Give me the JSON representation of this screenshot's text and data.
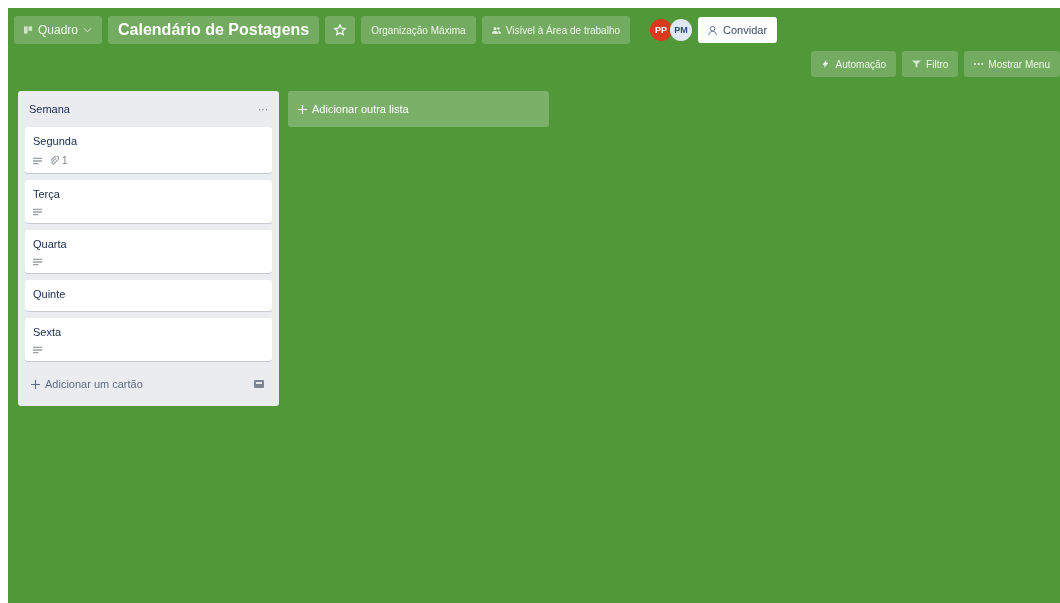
{
  "header": {
    "board_switcher": "Quadro",
    "board_title": "Calendário de Postagens",
    "starred": false,
    "team": "Organização Máxima",
    "visibility": "Visível à Área de trabalho",
    "members": [
      {
        "initials": "PP",
        "color": "#d93a1e"
      },
      {
        "initials": "PM",
        "color": "#dfe8f2"
      }
    ],
    "invite": "Convidar",
    "automation": "Automação",
    "filter": "Filtro",
    "menu": "Mostrar Menu"
  },
  "lists": [
    {
      "title": "Semana",
      "menu": "···",
      "add_card": "Adicionar um cartão",
      "cards": [
        {
          "title": "Segunda",
          "description": true,
          "attachments": "1"
        },
        {
          "title": "Terça",
          "description": true
        },
        {
          "title": "Quarta",
          "description": true
        },
        {
          "title": "Quinte",
          "description": false
        },
        {
          "title": "Sexta",
          "description": true
        }
      ]
    }
  ],
  "add_list": "Adicionar outra lista"
}
